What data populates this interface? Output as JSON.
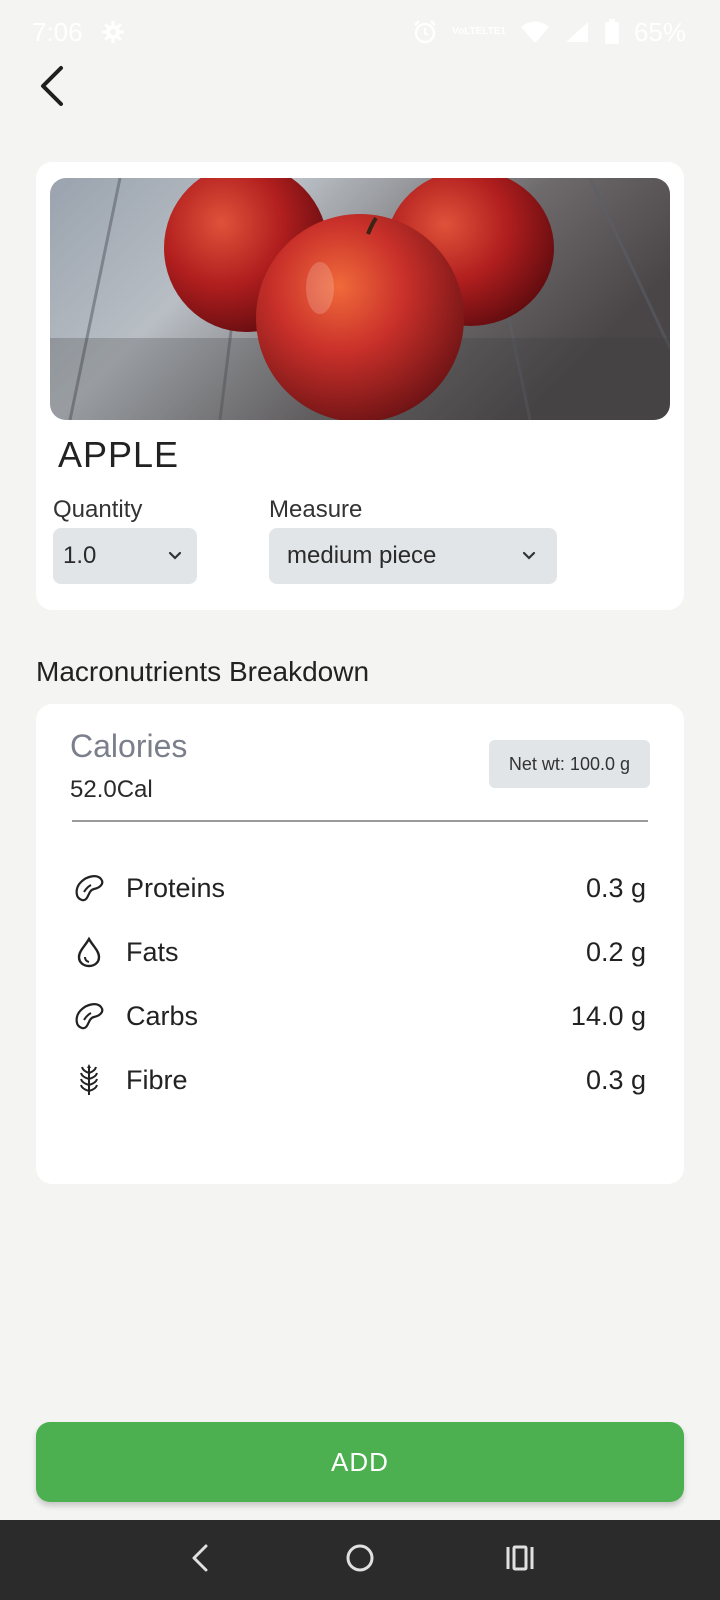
{
  "status_bar": {
    "time": "7:06",
    "battery": "65%",
    "icons": [
      "settings-gear-icon",
      "alarm-icon",
      "volte-icon",
      "wifi-icon",
      "signal-icon",
      "battery-icon"
    ],
    "volte_line1": "VoLTE",
    "volte_line2": "LTE1"
  },
  "back_icon": "chevron-left-icon",
  "food": {
    "name": "APPLE",
    "image": "apples-on-wooden-table-photo",
    "quantity_label": "Quantity",
    "quantity_value": "1.0",
    "measure_label": "Measure",
    "measure_value": "medium piece"
  },
  "macros": {
    "section_title": "Macronutrients Breakdown",
    "calories_label": "Calories",
    "calories_value": "52.0Cal",
    "net_weight": "Net wt: 100.0 g",
    "items": [
      {
        "name": "Proteins",
        "value": "0.3 g",
        "icon": "bean-icon"
      },
      {
        "name": "Fats",
        "value": "0.2 g",
        "icon": "drop-icon"
      },
      {
        "name": "Carbs",
        "value": "14.0 g",
        "icon": "bean-icon"
      },
      {
        "name": "Fibre",
        "value": "0.3 g",
        "icon": "wheat-icon"
      }
    ]
  },
  "add_button": "ADD",
  "nav_bar": {
    "buttons": [
      "nav-back-icon",
      "home-icon",
      "recents-icon"
    ]
  },
  "colors": {
    "background": "#f4f4f2",
    "card": "#ffffff",
    "accent_green": "#4caf50",
    "select_bg": "#e1e5e8",
    "nav_bar": "#2b2b2b"
  }
}
